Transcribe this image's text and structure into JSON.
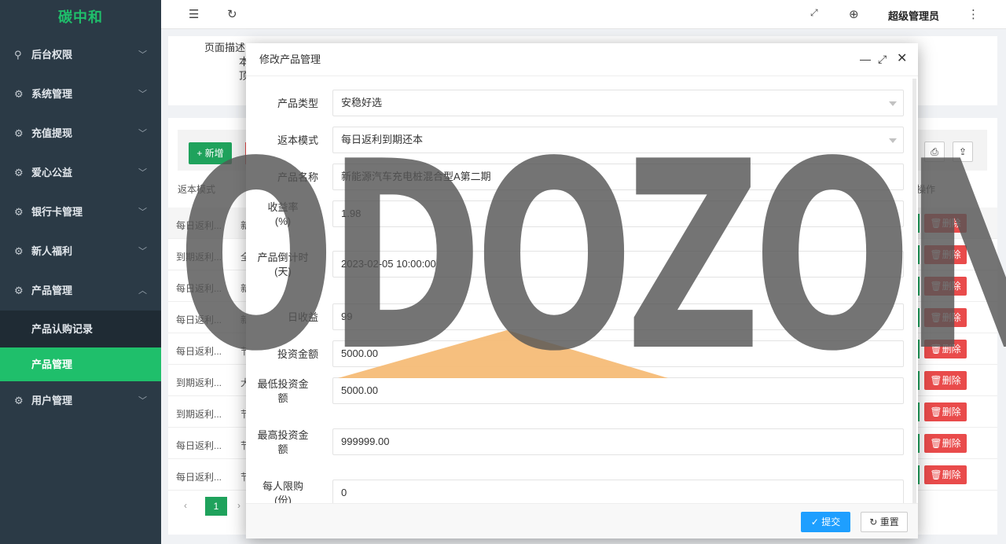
{
  "sidebar": {
    "logo": "碳中和",
    "items": [
      {
        "label": "后台权限",
        "icon": "user-icon"
      },
      {
        "label": "系统管理",
        "icon": "gear-icon"
      },
      {
        "label": "充值提现",
        "icon": "gear-icon"
      },
      {
        "label": "爱心公益",
        "icon": "gear-icon"
      },
      {
        "label": "银行卡管理",
        "icon": "gear-icon"
      },
      {
        "label": "新人福利",
        "icon": "gear-icon"
      },
      {
        "label": "产品管理",
        "icon": "gear-icon",
        "expanded": true
      },
      {
        "label": "用户管理",
        "icon": "gear-icon"
      }
    ],
    "subitems": [
      {
        "label": "产品认购记录",
        "active": false
      },
      {
        "label": "产品管理",
        "active": true
      }
    ]
  },
  "header": {
    "user": "超级管理员"
  },
  "page": {
    "desc_label": "页面描述",
    "desc_line2": "本",
    "desc_line3": "顶",
    "new_button": "+ 新增",
    "col_mode": "返本模式",
    "col_op": "操作",
    "rows": [
      {
        "mode": "每日返利...",
        "c2": "新"
      },
      {
        "mode": "到期返利...",
        "c2": "全"
      },
      {
        "mode": "每日返利...",
        "c2": "新"
      },
      {
        "mode": "每日返利...",
        "c2": "新"
      },
      {
        "mode": "每日返利...",
        "c2": "节"
      },
      {
        "mode": "到期返利...",
        "c2": "大"
      },
      {
        "mode": "到期返利...",
        "c2": "节"
      },
      {
        "mode": "每日返利...",
        "c2": "节"
      },
      {
        "mode": "每日返利...",
        "c2": "节"
      }
    ],
    "delete_label": "删除",
    "page_current": "1"
  },
  "modal": {
    "title": "修改产品管理",
    "fields": [
      {
        "label": "产品类型",
        "value": "安稳好选",
        "select": true
      },
      {
        "label": "返本模式",
        "value": "每日返利到期还本",
        "select": true
      },
      {
        "label": "产品名称",
        "value": "新能源汽车充电桩混合型A第二期"
      },
      {
        "label": "收益率\n(%)",
        "value": "1.98"
      },
      {
        "label": "产品倒计时\n(天)",
        "value": "2023-02-05 10:00:00"
      },
      {
        "label": "日收益",
        "value": "99"
      },
      {
        "label": "投资金额",
        "value": "5000.00"
      },
      {
        "label": "最低投资金\n额",
        "value": "5000.00"
      },
      {
        "label": "最高投资金\n额",
        "value": "999999.00"
      },
      {
        "label": "每人限购\n(份)",
        "value": "0"
      }
    ],
    "submit": "提交",
    "reset": "重置"
  },
  "watermark": "ODOZON",
  "colors": {
    "sidebar_bg": "#2b3a46",
    "accent_green": "#1fbf6b",
    "danger_red": "#e94b4b",
    "primary_blue": "#1e9fff",
    "watermark_triangle": "#f5b870"
  }
}
